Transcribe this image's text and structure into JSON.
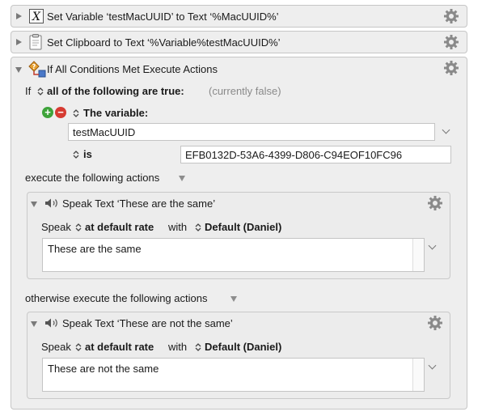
{
  "actions": [
    {
      "title": "Set Variable ‘testMacUUID’ to Text ‘%MacUUID%’",
      "icon": "variable-icon"
    },
    {
      "title": "Set Clipboard to Text ‘%Variable%testMacUUID%’",
      "icon": "clipboard-icon"
    }
  ],
  "if_action": {
    "title": "If All Conditions Met Execute Actions",
    "if_label": "If",
    "condition_mode": "all of the following are true:",
    "condition_status": "(currently false)",
    "condition": {
      "type_label": "The variable:",
      "variable_name": "testMacUUID",
      "operator": "is",
      "value": "EFB0132D-53A6-4399-D806-C94EOF10FC96"
    },
    "then_label": "execute the following actions",
    "else_label": "otherwise execute the following actions",
    "then_action": {
      "title": "Speak Text ‘These are the same’",
      "speak_label": "Speak",
      "rate": "at default rate",
      "with_label": "with",
      "voice": "Default (Daniel)",
      "text": "These are the same"
    },
    "else_action": {
      "title": "Speak Text ‘These are not the same’",
      "speak_label": "Speak",
      "rate": "at default rate",
      "with_label": "with",
      "voice": "Default (Daniel)",
      "text": "These are not the same"
    }
  },
  "colors": {
    "add_green": "#3ea33a",
    "remove_red": "#d63b32",
    "panel_bg": "#eeeeee"
  }
}
